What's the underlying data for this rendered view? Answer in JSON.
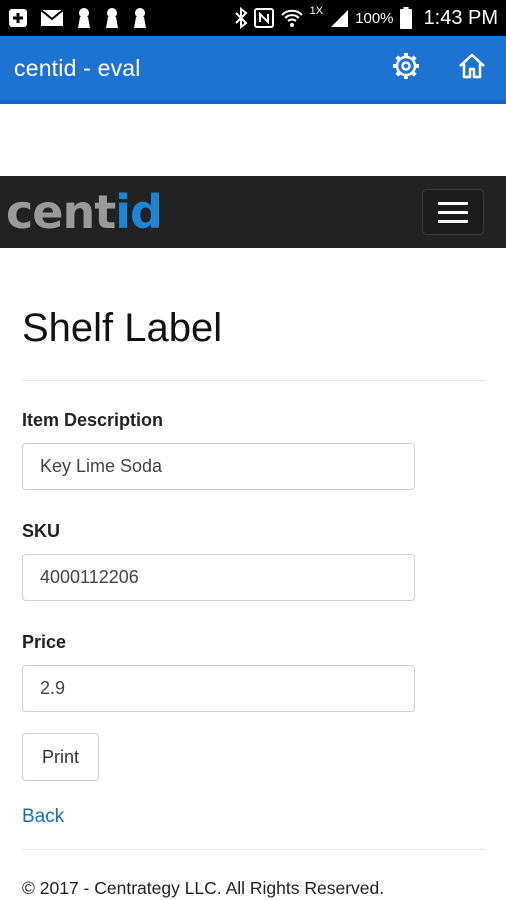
{
  "status_bar": {
    "network_label": "1X",
    "battery_percent": "100%",
    "time": "1:43 PM",
    "icons": [
      "plus-box-icon",
      "mail-icon",
      "keyhole-icon",
      "keyhole-icon",
      "keyhole-icon",
      "bluetooth-icon",
      "nfc-icon",
      "wifi-icon",
      "signal-icon",
      "battery-icon"
    ]
  },
  "app_bar": {
    "title": "centid - eval",
    "color": "#1e73d2",
    "actions": [
      "settings-gear-icon",
      "home-icon"
    ]
  },
  "navbar": {
    "logo_part1": "cent",
    "logo_part2": "id",
    "logo_color_1": "#9a9a9a",
    "logo_color_2": "#1a87d6",
    "menu_toggle": "hamburger-icon"
  },
  "page": {
    "title": "Shelf Label",
    "fields": {
      "item_description": {
        "label": "Item Description",
        "value": "Key Lime Soda"
      },
      "sku": {
        "label": "SKU",
        "value": "4000112206"
      },
      "price": {
        "label": "Price",
        "value": "2.9"
      }
    },
    "print_label": "Print",
    "back_label": "Back"
  },
  "footer": {
    "text": "© 2017 - Centrategy LLC. All Rights Reserved."
  }
}
